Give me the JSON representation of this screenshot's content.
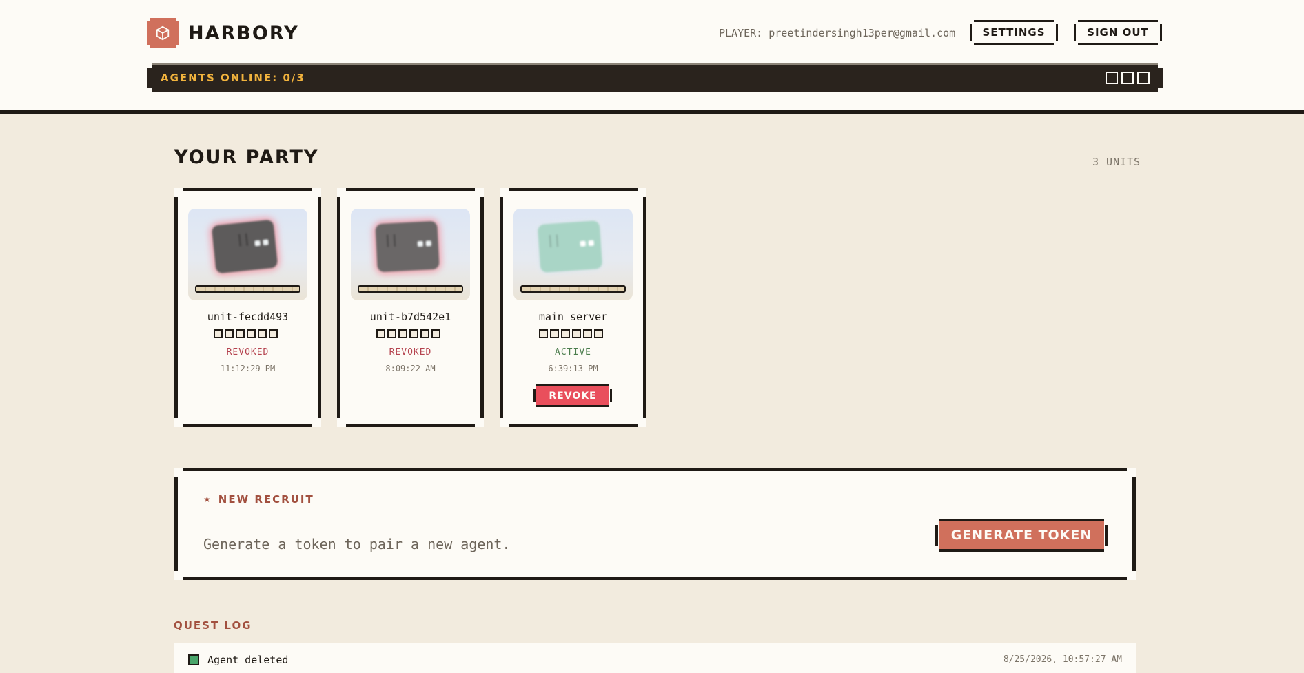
{
  "app": {
    "name": "HARBORY",
    "player_label": "PLAYER: preetindersingh13per@gmail.com",
    "settings_label": "SETTINGS",
    "signout_label": "SIGN OUT",
    "agents_online": "AGENTS ONLINE: 0/3"
  },
  "party": {
    "title": "YOUR PARTY",
    "count": "3 UNITS",
    "units": [
      {
        "name": "unit-fecdd493",
        "status": "REVOKED",
        "time": "11:12:29 PM"
      },
      {
        "name": "unit-b7d542e1",
        "status": "REVOKED",
        "time": "8:09:22 AM"
      },
      {
        "name": "main server",
        "status": "ACTIVE",
        "time": "6:39:13 PM",
        "action": "REVOKE"
      }
    ]
  },
  "recruit": {
    "title": "NEW RECRUIT",
    "star": "★",
    "description": "Generate a token to pair a new agent.",
    "button": "GENERATE TOKEN"
  },
  "quest_log": {
    "title": "QUEST LOG",
    "entries": [
      {
        "text": "Agent deleted",
        "time": "8/25/2026, 10:57:27 AM"
      }
    ]
  },
  "colors": {
    "accent": "#d0705c",
    "revoked": "#b5434f",
    "active": "#4b7d4d",
    "danger": "#e94f5c",
    "status_bar_text": "#f2b33d"
  },
  "icons": {
    "logo": "cube-icon",
    "star": "star-icon"
  }
}
